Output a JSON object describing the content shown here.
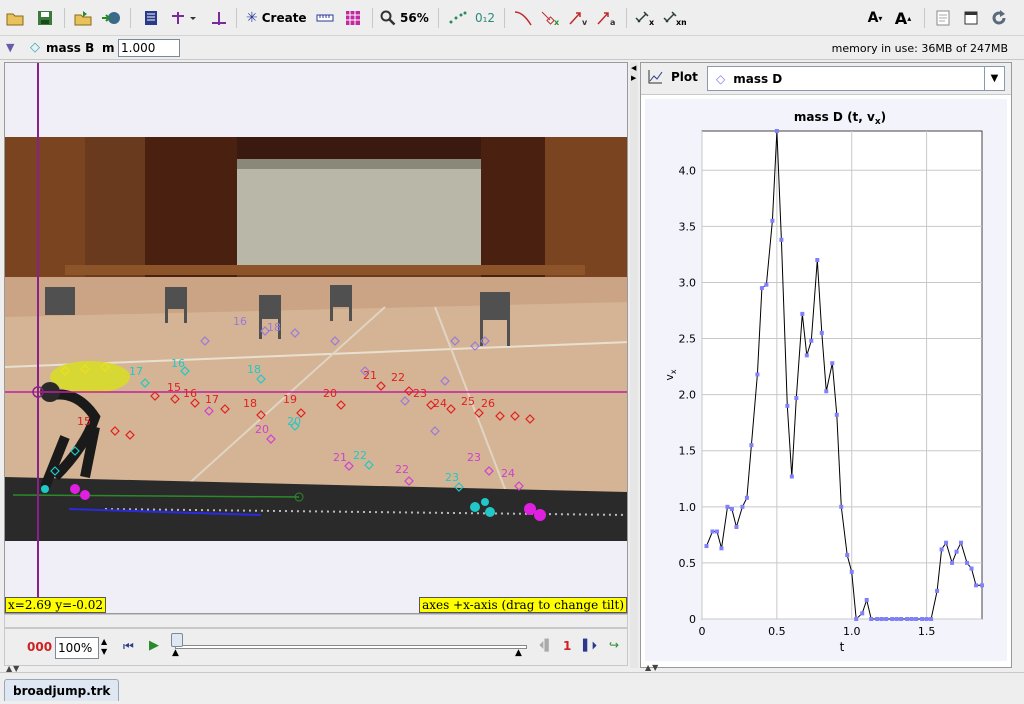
{
  "toolbar": {
    "create_label": "Create",
    "zoom_label": "56%",
    "icons": [
      "open-folder-icon",
      "save-icon",
      "import-icon",
      "video-clip-icon",
      "clip-settings-icon",
      "coordinate-axes-icon",
      "calibration-icon",
      "create-track-icon",
      "tape-measure-icon",
      "color-grid-icon",
      "zoom-icon",
      "trail-icon",
      "labels-icon",
      "path-icon",
      "position-icon",
      "velocity-icon",
      "acceleration-icon",
      "x-vector-icon",
      "xm-vector-icon",
      "font-smaller-icon",
      "font-larger-icon",
      "notes-icon",
      "window-icon",
      "refresh-icon"
    ]
  },
  "trackbar": {
    "track_name": "mass B",
    "mass_label": "m",
    "mass_value": "1.000",
    "memory_text": "memory in use: 36MB of 247MB"
  },
  "video": {
    "coord_readout": "x=2.69  y=-0.02",
    "axes_hint": "axes +x-axis (drag to change tilt)"
  },
  "player": {
    "frame_counter": "000",
    "rate_value": "100%",
    "step_size": "1"
  },
  "plot": {
    "plot_label": "Plot",
    "track_select": "mass D",
    "colors": {
      "line": "#000000",
      "point": "#8080ff",
      "grid": "#c8c8c8"
    }
  },
  "chart_data": {
    "type": "line",
    "title": "mass D (t, v",
    "title_sub": "x",
    "title_end": ")",
    "xlabel": "t",
    "ylabel": "v",
    "ylabel_sub": "x",
    "xlim": [
      0,
      1.87
    ],
    "ylim": [
      0,
      4.35
    ],
    "xticks": [
      "0",
      "0.5",
      "1.0",
      "1.5"
    ],
    "xtick_values": [
      0,
      0.5,
      1.0,
      1.5
    ],
    "yticks": [
      "0",
      "0.5",
      "1.0",
      "1.5",
      "2.0",
      "2.5",
      "3.0",
      "3.5",
      "4.0"
    ],
    "ytick_values": [
      0,
      0.5,
      1.0,
      1.5,
      2.0,
      2.5,
      3.0,
      3.5,
      4.0
    ],
    "series": [
      {
        "x": [
          0.03,
          0.07,
          0.1,
          0.13,
          0.17,
          0.2,
          0.23,
          0.27,
          0.3,
          0.33,
          0.37,
          0.4,
          0.43,
          0.47,
          0.5,
          0.53,
          0.57,
          0.6,
          0.63,
          0.67,
          0.7,
          0.73,
          0.77,
          0.8,
          0.83,
          0.87,
          0.9,
          0.93,
          0.97,
          1.0,
          1.03,
          1.07,
          1.1,
          1.13,
          1.17,
          1.2,
          1.23,
          1.27,
          1.3,
          1.33,
          1.37,
          1.4,
          1.43,
          1.47,
          1.5,
          1.53,
          1.57,
          1.6,
          1.63,
          1.67,
          1.7,
          1.73,
          1.77,
          1.8,
          1.83,
          1.87
        ],
        "y": [
          0.65,
          0.78,
          0.78,
          0.63,
          1.0,
          0.98,
          0.82,
          1.0,
          1.08,
          1.55,
          2.18,
          2.95,
          2.98,
          3.55,
          4.35,
          3.38,
          1.9,
          1.27,
          1.97,
          2.72,
          2.35,
          2.48,
          3.2,
          2.55,
          2.03,
          2.28,
          1.82,
          1.0,
          0.57,
          0.42,
          0.0,
          0.05,
          0.17,
          0.0,
          0.0,
          0.0,
          0.0,
          0.0,
          0.0,
          0.0,
          0.0,
          0.0,
          0.0,
          0.0,
          0.0,
          0.0,
          0.25,
          0.62,
          0.68,
          0.5,
          0.6,
          0.68,
          0.5,
          0.45,
          0.3,
          0.3
        ]
      }
    ]
  }
}
